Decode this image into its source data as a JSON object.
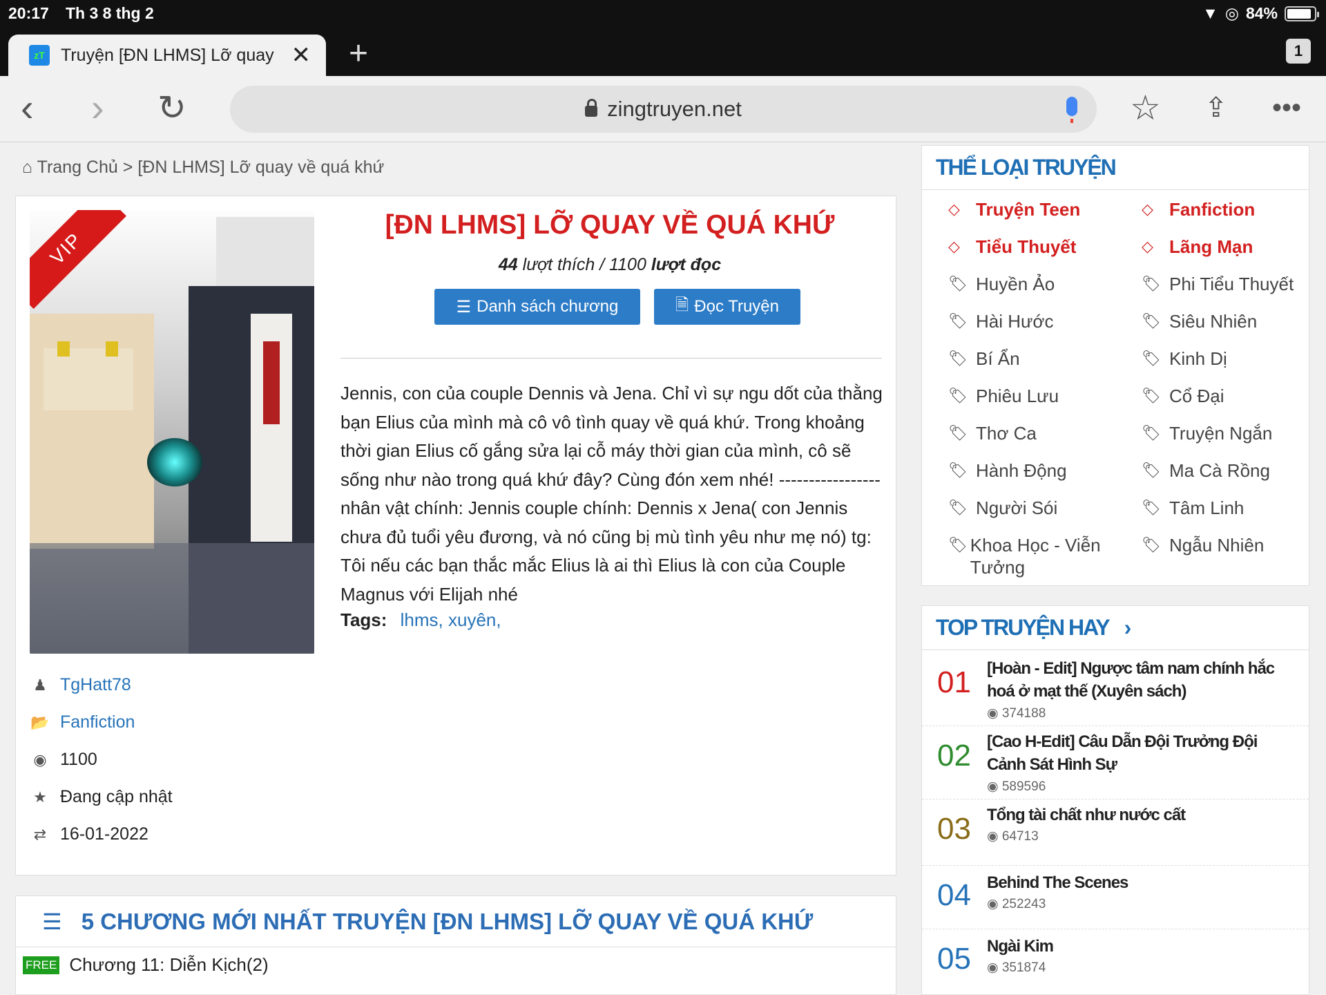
{
  "status": {
    "time": "20:17",
    "date": "Th 3 8 thg 2",
    "battery": "84%"
  },
  "browser": {
    "tab_title": "Truyện [ĐN LHMS] Lỡ quay",
    "favicon": "zT",
    "url": "zingtruyen.net",
    "tab_count": "1"
  },
  "breadcrumb": {
    "home": "Trang Chủ",
    "sep": ">",
    "current": "[ĐN LHMS] Lỡ quay về quá khứ"
  },
  "story": {
    "badge": "VIP",
    "title": "[ĐN LHMS] LỠ QUAY VỀ QUÁ KHỨ",
    "likes": "44",
    "likes_label": "lượt thích /",
    "reads_text": "1100",
    "reads_label": "lượt đọc",
    "btn_list": "Danh sách chương",
    "btn_read": "Đọc Truyện",
    "description": "Jennis, con của couple Dennis và Jena. Chỉ vì sự ngu dốt của thằng bạn Elius của mình mà cô vô tình quay về quá khứ. Trong khoảng thời gian Elius cố gắng sửa lại cỗ máy thời gian của mình, cô sẽ sống như nào trong quá khứ đây? Cùng đón xem nhé! ----------------- nhân vật chính: Jennis couple chính: Dennis x Jena( con Jennis chưa đủ tuổi yêu đương, và nó cũng bị mù tình yêu như mẹ nó) tg: Tôi nếu các bạn thắc mắc Elius là ai thì Elius là con của Couple Magnus với Elijah nhé",
    "tags_label": "Tags:",
    "tags": "lhms, xuyên,",
    "author": "TgHatt78",
    "genre": "Fanfiction",
    "views": "1100",
    "status": "Đang cập nhật",
    "updated": "16-01-2022"
  },
  "chapters": {
    "heading": "5 CHƯƠNG MỚI NHẤT TRUYỆN [ĐN LHMS] LỠ QUAY VỀ QUÁ KHỨ",
    "first_badge": "FREE",
    "first_title": "Chương 11: Diễn Kịch(2)"
  },
  "categories": {
    "heading": "THỂ LOẠI TRUYỆN",
    "hot": [
      "Truyện Teen",
      "Fanfiction",
      "Tiểu Thuyết",
      "Lãng Mạn"
    ],
    "items": [
      "Huyền Ảo",
      "Phi Tiểu Thuyết",
      "Hài Hước",
      "Siêu Nhiên",
      "Bí Ẩn",
      "Kinh Dị",
      "Phiêu Lưu",
      "Cổ Đại",
      "Thơ Ca",
      "Truyện Ngắn",
      "Hành Động",
      "Ma Cà Rồng",
      "Người Sói",
      "Tâm Linh",
      "Khoa Học - Viễn Tưởng",
      "Ngẫu Nhiên"
    ]
  },
  "top": {
    "heading": "TOP TRUYỆN HAY",
    "items": [
      {
        "rank": "01",
        "title": "[Hoàn - Edit] Ngược tâm nam chính hắc hoá ở mạt thế (Xuyên sách)",
        "views": "374188",
        "color": "#d31f1f"
      },
      {
        "rank": "02",
        "title": "[Cao H-Edit] Câu Dẫn Đội Trưởng Đội Cảnh Sát Hình Sự",
        "views": "589596",
        "color": "#2e8b2e"
      },
      {
        "rank": "03",
        "title": "Tổng tài chất như nước cất",
        "views": "64713",
        "color": "#8a6d1a"
      },
      {
        "rank": "04",
        "title": "Behind The Scenes",
        "views": "252243",
        "color": "#2673b8"
      },
      {
        "rank": "05",
        "title": "Ngài Kim",
        "views": "351874",
        "color": "#2673b8"
      }
    ]
  },
  "colors": {
    "accent": "#2c7cc8",
    "title_red": "#d31f1f",
    "heading_blue": "#1f6fb5"
  },
  "icons": [
    "home-icon",
    "user-icon",
    "folder-icon",
    "eye-icon",
    "star-icon",
    "refresh-icon",
    "list-icon",
    "file-icon",
    "diamond-icon",
    "tag-icon",
    "chevron-right-icon"
  ]
}
